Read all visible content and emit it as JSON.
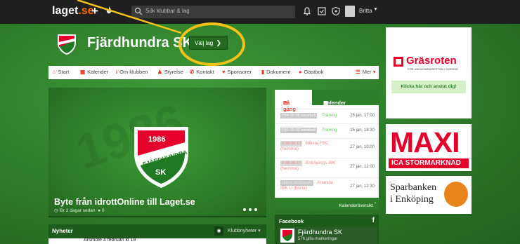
{
  "topbar": {
    "logo_main": "laget",
    "logo_suffix": ".se",
    "plus_label": "+",
    "search": {
      "placeholder": "Sök klubbar & lag"
    },
    "icons": [
      "bell-icon",
      "checkbox-icon",
      "shield-icon"
    ],
    "user": {
      "name": "Britta"
    }
  },
  "club": {
    "name": "Fjärdhundra SK",
    "crest_year": "1986",
    "crest_text": "FJÄRDHUNDRA",
    "crest_abbr": "SK",
    "team_button_label": "Välj lag"
  },
  "nav": {
    "items": [
      {
        "label": "Start",
        "icon": "home-icon"
      },
      {
        "label": "Kalender",
        "icon": "calendar-icon"
      },
      {
        "label": "Om klubben",
        "icon": "info-icon"
      },
      {
        "label": "Styrelse",
        "icon": "person-icon"
      },
      {
        "label": "Kontakt",
        "icon": "phone-icon"
      },
      {
        "label": "Sponsorer",
        "icon": "heart-icon"
      },
      {
        "label": "Dokument",
        "icon": "document-icon"
      },
      {
        "label": "Gästbok",
        "icon": "chat-icon"
      },
      {
        "label": "Mer",
        "icon": "menu-icon"
      }
    ]
  },
  "hero": {
    "watermark": "1986",
    "title": "Byte från idrottOnline till Laget.se",
    "meta": "för 2 dagar sedan",
    "comments": "0"
  },
  "news": {
    "title": "Nyheter",
    "filter_label": "Klubbnyheter",
    "first_item": "Årsmöte 4 februari kl 19"
  },
  "activity": {
    "tab_active": "På gång",
    "tab_inactive": "Kalender",
    "events": [
      {
        "tag": "P04-05-06 handboll",
        "title": "Träning",
        "date": "25 jan, 17:00",
        "kind": "training"
      },
      {
        "tag": "P01-02-03 handboll",
        "title": "Träning",
        "date": "25 jan, 18:30",
        "kind": "training"
      },
      {
        "tag": "P 08-09-10",
        "title": "Bålsta FBC (hemma)",
        "date": "27 jan, 10:00",
        "kind": "match"
      },
      {
        "tag": "P 08-09-10",
        "title": "Enköpings IBK (hemma)",
        "date": "27 jan, 12:00",
        "kind": "match"
      },
      {
        "tag": "Herrar innebandy",
        "title": "Arlanda IBK U (borta)",
        "date": "27 jan, 12:30",
        "kind": "match"
      }
    ],
    "overview_link": "Kalenderöversikt"
  },
  "facebook": {
    "title": "Facebook",
    "page_name": "Fjärdhundra SK",
    "likes": "576 gilla-markeringar"
  },
  "ads": {
    "grasroten_title": "Gräsroten",
    "grasroten_sub": "FÖR UNGDOMSIDROTTEN I SVERIGE",
    "grasroten_button": "Klicka här och anslut dig!",
    "maxi_title": "MAXI",
    "maxi_sub": "ICA STORMARKNAD",
    "sparbanken_line1": "Sparbanken",
    "sparbanken_line2": "i Enköping"
  },
  "colors": {
    "brand_green": "#2e7d2b",
    "accent_red": "#e4002b",
    "highlight_yellow": "#f2c21a"
  }
}
